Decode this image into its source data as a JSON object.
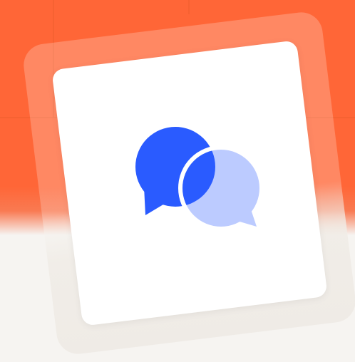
{
  "icon": "chat-bubbles-icon",
  "colors": {
    "background_top": "#ff6637",
    "background_bottom": "#f6f4f1",
    "card_frame": "#efebe6",
    "card": "#ffffff",
    "bubble_primary": "#2a5bff",
    "bubble_secondary": "#bccbff"
  }
}
